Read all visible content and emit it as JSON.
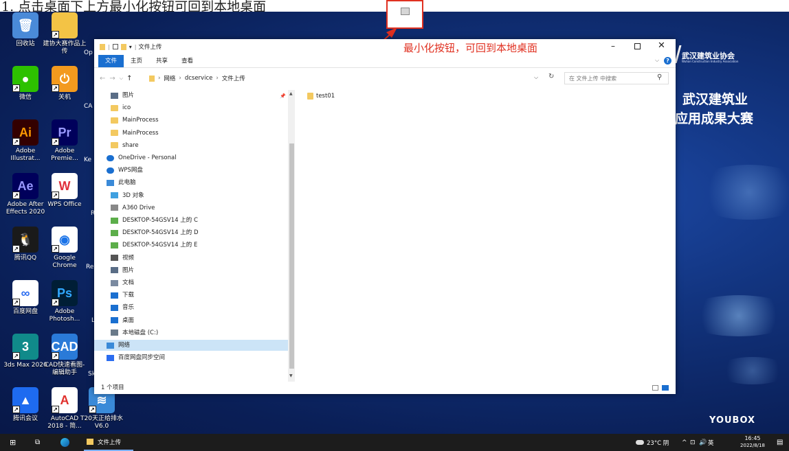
{
  "instruction": "1. 点击桌面下上方最小化按钮可回到本地桌面",
  "annotation": {
    "callout": "最小化按钮，可回到本地桌面",
    "color": "#e03020"
  },
  "desktop": {
    "icons": [
      {
        "label": "回收站",
        "color": "#4a8ad8",
        "glyph": "🗑"
      },
      {
        "label": "建协大赛作品上传",
        "color": "#f3c345",
        "glyph": ""
      },
      {
        "label": "微信",
        "color": "#2dc100",
        "glyph": "●"
      },
      {
        "label": "关机",
        "color": "#f39a1e",
        "glyph": "⏻"
      },
      {
        "label": "Adobe Illustrat...",
        "color": "#330000",
        "glyph": "Ai",
        "fg": "#ff9a00"
      },
      {
        "label": "Adobe Premie...",
        "color": "#00005b",
        "glyph": "Pr",
        "fg": "#9999ff"
      },
      {
        "label": "Adobe After Effects 2020",
        "color": "#00005b",
        "glyph": "Ae",
        "fg": "#9999ff"
      },
      {
        "label": "WPS Office",
        "color": "#ffffff",
        "glyph": "W",
        "fg": "#e0303c"
      },
      {
        "label": "腾讯QQ",
        "color": "#1a1a1a",
        "glyph": "🐧"
      },
      {
        "label": "Google Chrome",
        "color": "#ffffff",
        "glyph": "◉",
        "fg": "#1a73e8"
      },
      {
        "label": "百度网盘",
        "color": "#ffffff",
        "glyph": "∞",
        "fg": "#2a6cf0"
      },
      {
        "label": "Adobe Photosh...",
        "color": "#001e36",
        "glyph": "Ps",
        "fg": "#31a8ff"
      },
      {
        "label": "3ds Max 2020",
        "color": "#108a8a",
        "glyph": "3"
      },
      {
        "label": "CAD快速看图-编辑助手",
        "color": "#2a7ad8",
        "glyph": "CAD"
      },
      {
        "label": "腾讯会议",
        "color": "#1e6bf0",
        "glyph": "▲"
      },
      {
        "label": "AutoCAD 2018 - 简...",
        "color": "#ffffff",
        "glyph": "A",
        "fg": "#e0302c"
      },
      {
        "label": "T20天正给排水V6.0",
        "color": "#3a8ad8",
        "glyph": "≋"
      }
    ],
    "partial_labels": [
      "Op",
      "CA",
      "Ke",
      "R",
      "Re",
      "L",
      "Sk"
    ],
    "logo": {
      "name": "武汉建筑业协会",
      "subtitle": "Wuhan Construction Industry Association"
    },
    "banner": [
      "武汉建筑业",
      "应用成果大赛"
    ],
    "brand": "YOUBOX"
  },
  "explorer": {
    "title": "文件上传",
    "ribbon_tabs": [
      "文件",
      "主页",
      "共享",
      "查看"
    ],
    "path": [
      "网络",
      "dcservice",
      "文件上传"
    ],
    "search_placeholder": "在 文件上传 中搜索",
    "nav": [
      {
        "label": "图片",
        "icon": "pictures-icon",
        "level": 1
      },
      {
        "label": "ico",
        "icon": "folder-icon",
        "level": 1
      },
      {
        "label": "MainProcess",
        "icon": "folder-icon",
        "level": 1
      },
      {
        "label": "MainProcess",
        "icon": "folder-icon",
        "level": 1
      },
      {
        "label": "share",
        "icon": "folder-icon",
        "level": 1
      },
      {
        "label": "OneDrive - Personal",
        "icon": "cloud-icon",
        "level": 0
      },
      {
        "label": "WPS网盘",
        "icon": "cloud-icon",
        "level": 0
      },
      {
        "label": "此电脑",
        "icon": "computer-icon",
        "level": 0
      },
      {
        "label": "3D 对象",
        "icon": "3d-objects-icon",
        "level": 1
      },
      {
        "label": "A360 Drive",
        "icon": "drive-icon",
        "level": 1
      },
      {
        "label": "DESKTOP-54GSV14 上的 C",
        "icon": "network-drive-icon",
        "level": 1
      },
      {
        "label": "DESKTOP-54GSV14 上的 D",
        "icon": "network-drive-icon",
        "level": 1
      },
      {
        "label": "DESKTOP-54GSV14 上的 E",
        "icon": "network-drive-icon",
        "level": 1
      },
      {
        "label": "视频",
        "icon": "video-icon",
        "level": 1
      },
      {
        "label": "图片",
        "icon": "pictures-icon",
        "level": 1
      },
      {
        "label": "文档",
        "icon": "documents-icon",
        "level": 1
      },
      {
        "label": "下载",
        "icon": "download-icon",
        "level": 1
      },
      {
        "label": "音乐",
        "icon": "music-icon",
        "level": 1
      },
      {
        "label": "桌面",
        "icon": "desktop-icon",
        "level": 1
      },
      {
        "label": "本地磁盘 (C:)",
        "icon": "disk-icon",
        "level": 1
      },
      {
        "label": "网络",
        "icon": "network-icon",
        "level": 0,
        "selected": true
      },
      {
        "label": "百度网盘同步空间",
        "icon": "sync-icon",
        "level": 0
      }
    ],
    "files": [
      {
        "name": "test01",
        "type": "folder"
      }
    ],
    "status": "1 个项目"
  },
  "taskbar": {
    "app_label": "文件上传",
    "weather": "23°C 阴",
    "ime": "英",
    "time": "16:45",
    "date": "2022/8/18"
  }
}
